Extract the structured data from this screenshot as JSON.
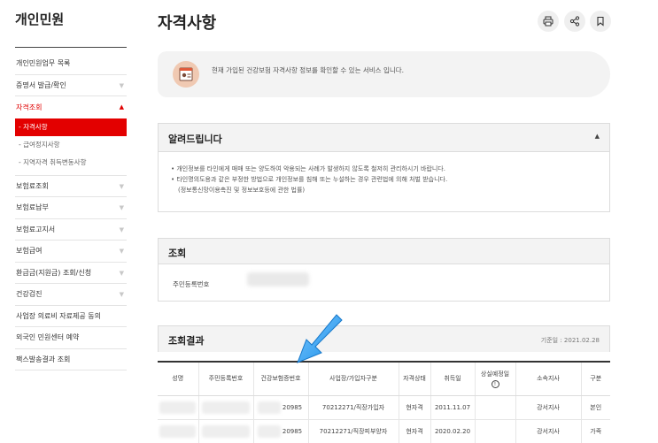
{
  "sidebar": {
    "title": "개인민원",
    "items": [
      {
        "label": "개인민원업무 목록",
        "chevron": false
      },
      {
        "label": "증명서 발급/확인",
        "chevron": true
      },
      {
        "label": "자격조회",
        "chevron": true,
        "active": true
      },
      {
        "label": "보험료조회",
        "chevron": true
      },
      {
        "label": "보험료납부",
        "chevron": true
      },
      {
        "label": "보험료고지서",
        "chevron": true
      },
      {
        "label": "보험급여",
        "chevron": true
      },
      {
        "label": "환급금(지원금) 조회/신청",
        "chevron": true
      },
      {
        "label": "건강검진",
        "chevron": true
      },
      {
        "label": "사업장 의료비 자료제공 동의",
        "chevron": false
      },
      {
        "label": "외국인 민원센터 예약",
        "chevron": false
      },
      {
        "label": "팩스발송결과 조회",
        "chevron": false
      }
    ],
    "subitems": [
      {
        "label": "- 자격사항",
        "active": true
      },
      {
        "label": "- 급여정지사항",
        "active": false
      },
      {
        "label": "- 지역자격 취득변동사항",
        "active": false
      }
    ]
  },
  "header": {
    "title": "자격사항"
  },
  "banner": {
    "text": "현재 가입된 건강보험 자격사항 정보를 확인할 수 있는 서비스 입니다."
  },
  "notice": {
    "title": "알려드립니다",
    "lines": [
      "• 개인정보를 타인에게 매매 또는 양도하여 악용되는 사례가 발생하지 않도록 철저히 관리하시기 바랍니다.",
      "• 타인명의도용과 같은 부정한 방법으로 개인정보를 침해 또는 누설하는 경우 관련법에 의해 처벌 받습니다.",
      "(정보통신망이용촉진 및 정보보호등에 관한 법률)"
    ]
  },
  "search": {
    "title": "조회",
    "label": "주민등록번호"
  },
  "results": {
    "title": "조회결과",
    "date": "기준일 : 2021.02.28",
    "columns": [
      "성명",
      "주민등록번호",
      "건강보험증번호",
      "사업장/가입자구분",
      "자격상태",
      "취득일",
      "상실예정일",
      "소속지사",
      "구분"
    ],
    "rows": [
      {
        "card": "20985",
        "type": "70212271/직장가입자",
        "status": "현자격",
        "acquired": "2011.11.07",
        "expected": "",
        "branch": "강서지사",
        "kind": "본인"
      },
      {
        "card": "20985",
        "type": "70212271/직장피부양자",
        "status": "현자격",
        "acquired": "2020.02.20",
        "expected": "",
        "branch": "강서지사",
        "kind": "가족"
      }
    ]
  },
  "colors": {
    "accent": "#e30000",
    "arrow": "#2a9df4"
  }
}
